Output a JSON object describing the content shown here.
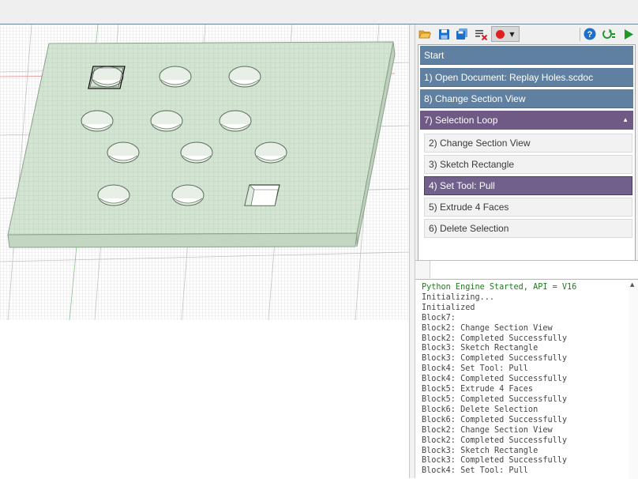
{
  "toolbar": {
    "icons": [
      "open-folder-icon",
      "save-icon",
      "save-as-icon",
      "clear-icon",
      "record-icon",
      "help-icon",
      "step-icon",
      "run-icon"
    ],
    "colors": {
      "blue": "#1e6fc8",
      "red": "#e02020",
      "green": "#1c9a2a"
    }
  },
  "blocks": {
    "start": "Start",
    "open_document": "1) Open Document: Replay Holes.scdoc",
    "change_section_view": "8) Change Section View",
    "selection_loop": "7) Selection Loop",
    "loop_items": [
      "2) Change Section View",
      "3) Sketch Rectangle",
      "4) Set Tool: Pull",
      "5) Extrude 4 Faces",
      "6) Delete Selection"
    ]
  },
  "console": {
    "lines": [
      "Python Engine Started, API = V16",
      "Initializing...",
      "Initialized",
      "Block7:",
      "Block2: Change Section View",
      "Block2: Completed Successfully",
      "Block3: Sketch Rectangle",
      "Block3: Completed Successfully",
      "Block4: Set Tool: Pull",
      "Block4: Completed Successfully",
      "Block5: Extrude 4 Faces",
      "Block5: Completed Successfully",
      "Block6: Delete Selection",
      "Block6: Completed Successfully",
      "Block2: Change Section View",
      "Block2: Completed Successfully",
      "Block3: Sketch Rectangle",
      "Block3: Completed Successfully",
      "Block4: Set Tool: Pull"
    ]
  },
  "colors": {
    "block_blue": "#5f80a0",
    "block_purple": "#6f5a86",
    "plate_fill": "#d3e4d2",
    "console_ok": "#1f7a1f"
  }
}
